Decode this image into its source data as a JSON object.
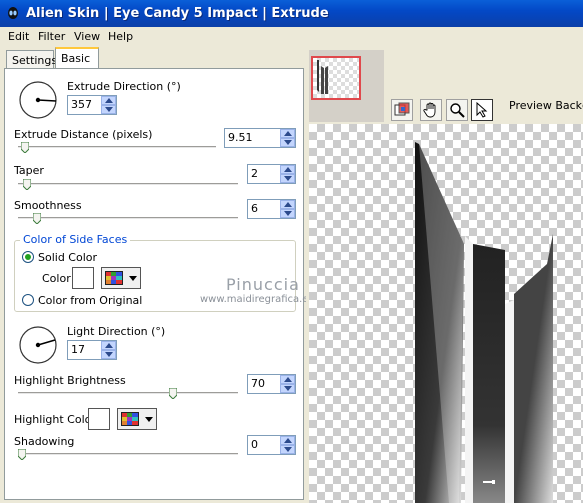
{
  "window": {
    "title": "Alien Skin | Eye Candy 5 Impact | Extrude"
  },
  "menu": [
    "Edit",
    "Filter",
    "View",
    "Help"
  ],
  "tabs": [
    {
      "label": "Settings",
      "active": false
    },
    {
      "label": "Basic",
      "active": true
    }
  ],
  "controls": {
    "extrude_direction": {
      "label": "Extrude Direction (°)",
      "value": "357"
    },
    "extrude_distance": {
      "label": "Extrude Distance (pixels)",
      "value": "9.51"
    },
    "taper": {
      "label": "Taper",
      "value": "2"
    },
    "smoothness": {
      "label": "Smoothness",
      "value": "6"
    },
    "side_faces": {
      "group_label": "Color of Side Faces",
      "solid_color_label": "Solid Color",
      "color_label": "Color",
      "from_original_label": "Color from Original",
      "selected": "solid"
    },
    "light_direction": {
      "label": "Light Direction (°)",
      "value": "17"
    },
    "highlight_brightness": {
      "label": "Highlight Brightness",
      "value": "70"
    },
    "highlight_color": {
      "label": "Highlight Color"
    },
    "shadowing": {
      "label": "Shadowing",
      "value": "0"
    }
  },
  "preview": {
    "background_label": "Preview Backgrou"
  },
  "watermark": {
    "name": "Pinuccia",
    "url": "www.maidiregrafica.eu"
  },
  "tools": [
    "preview-toggle-icon",
    "hand-icon",
    "zoom-icon",
    "pointer-icon"
  ]
}
